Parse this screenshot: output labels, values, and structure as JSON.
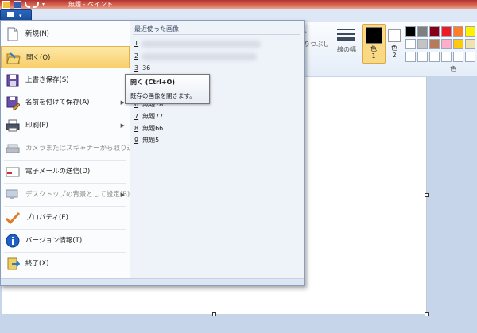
{
  "window": {
    "title": "無題 - ペイント"
  },
  "ribbon": {
    "partial_label_1": "ﾄ",
    "partial_label_2": "りつぶし",
    "size_label": "線の幅",
    "color1_label": "色\n1",
    "color1_num": "1",
    "color1_char": "色",
    "color2_char": "色",
    "color2_num": "2",
    "colors_group_label": "色",
    "palette": [
      "#000000",
      "#7f7f7f",
      "#880015",
      "#ed1c24",
      "#ff7f27",
      "#fff200",
      "#22b14c",
      "#ffffff",
      "#c3c3c3",
      "#b97a57",
      "#ffaec9",
      "#ffc90e",
      "#efe4b0",
      "#b5e61d",
      "#ffffff",
      "#ffffff",
      "#ffffff",
      "#ffffff",
      "#ffffff",
      "#ffffff",
      "#ffffff"
    ]
  },
  "file_menu": {
    "items": [
      {
        "label": "新規(N)",
        "key": "N"
      },
      {
        "label": "開く(O)",
        "key": "O"
      },
      {
        "label": "上書き保存(S)",
        "key": "S"
      },
      {
        "label": "名前を付けて保存(A)",
        "key": "A"
      },
      {
        "label": "印刷(P)",
        "key": "P"
      },
      {
        "label": "カメラまたはスキャナーから取り込み(M)",
        "key": "M"
      },
      {
        "label": "電子メールの送信(D)",
        "key": "D"
      },
      {
        "label": "デスクトップの背景として設定(B)",
        "key": "B"
      },
      {
        "label": "プロパティ(E)",
        "key": "E"
      },
      {
        "label": "バージョン情報(T)",
        "key": "T"
      },
      {
        "label": "終了(X)",
        "key": "X"
      }
    ],
    "recent_title": "最近使った画像",
    "recent": [
      {
        "num": "1",
        "name": ""
      },
      {
        "num": "2",
        "name": ""
      },
      {
        "num": "3",
        "name": "36+"
      },
      {
        "num": "6",
        "name": "無題78"
      },
      {
        "num": "7",
        "name": "無題77"
      },
      {
        "num": "8",
        "name": "無題66"
      },
      {
        "num": "9",
        "name": "無題5"
      }
    ]
  },
  "tooltip": {
    "title": "開く (Ctrl+O)",
    "description": "既存の画像を開きます。"
  }
}
